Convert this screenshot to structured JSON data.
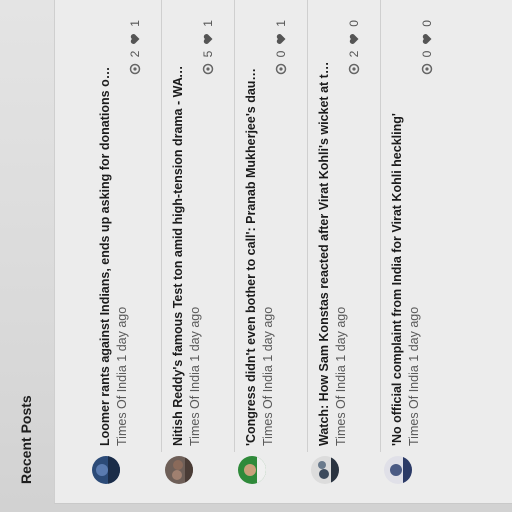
{
  "section": {
    "title": "Recent Posts"
  },
  "posts": [
    {
      "title": "Loomer rants against Indians, ends up asking for donations on app built...",
      "meta": "Times Of India 1 day ago",
      "views": "2",
      "likes": "1",
      "avatar_color": "#2c4b78"
    },
    {
      "title": "Nitish Reddy's famous Test ton amid high-tension drama - WATCH",
      "meta": "Times Of India 1 day ago",
      "views": "5",
      "likes": "1",
      "avatar_color": "#6e5f58"
    },
    {
      "title": "'Congress didn't even bother to call': Pranab Mukherjee's daughter on ...",
      "meta": "Times Of India 1 day ago",
      "views": "0",
      "likes": "1",
      "avatar_color": "#2f8a3a"
    },
    {
      "title": "Watch: How Sam Konstas reacted after Virat Kohli's wicket at the MCG",
      "meta": "Times Of India 1 day ago",
      "views": "2",
      "likes": "0",
      "avatar_color": "#3c4a5c"
    },
    {
      "title": "'No official complaint from India for Virat Kohli heckling'",
      "meta": "Times Of India 1 day ago",
      "views": "0",
      "likes": "0",
      "avatar_color": "#4a5a84"
    }
  ]
}
